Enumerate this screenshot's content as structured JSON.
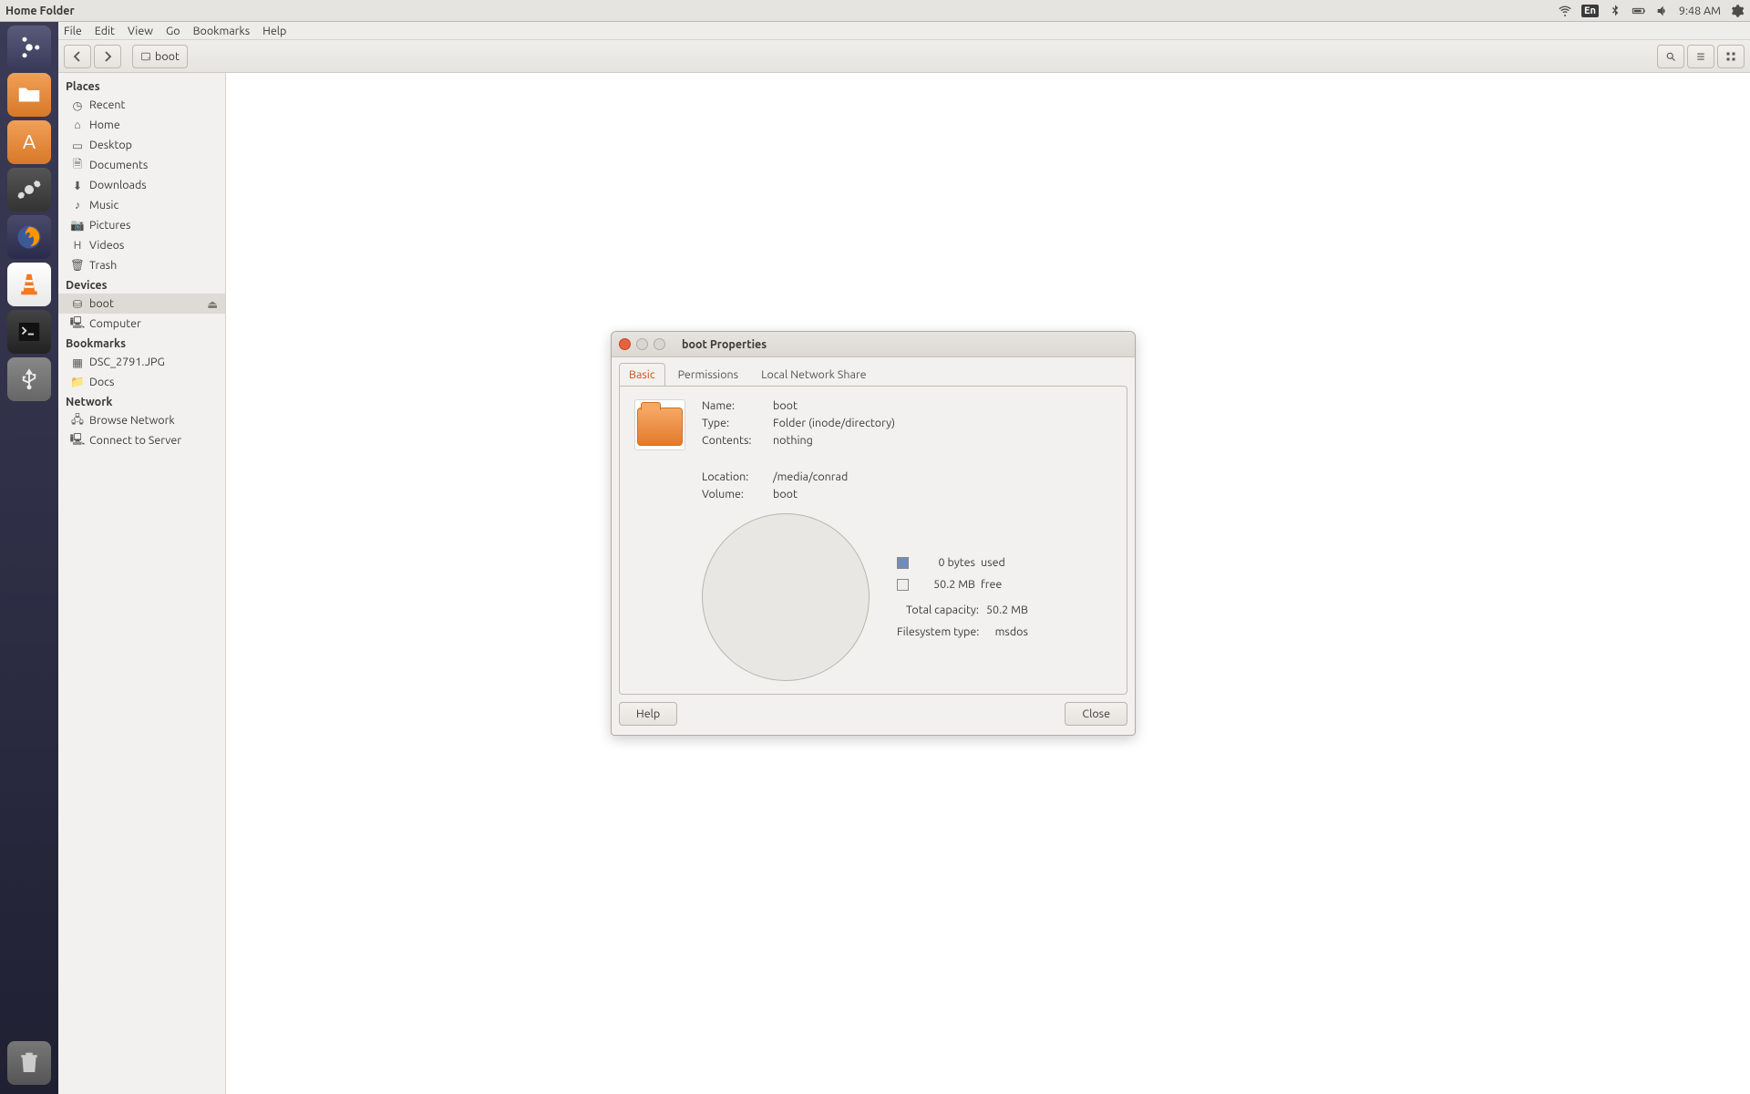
{
  "panel": {
    "title": "Home Folder",
    "lang_indicator": "En",
    "time": "9:48 AM"
  },
  "menubar": {
    "items": [
      "File",
      "Edit",
      "View",
      "Go",
      "Bookmarks",
      "Help"
    ]
  },
  "toolbar": {
    "path_label": "boot"
  },
  "sidebar": {
    "sections": [
      {
        "title": "Places",
        "items": [
          {
            "icon": "clock-icon",
            "label": "Recent"
          },
          {
            "icon": "home-icon",
            "label": "Home"
          },
          {
            "icon": "desktop-icon",
            "label": "Desktop"
          },
          {
            "icon": "doc-icon",
            "label": "Documents"
          },
          {
            "icon": "download-icon",
            "label": "Downloads"
          },
          {
            "icon": "music-icon",
            "label": "Music"
          },
          {
            "icon": "camera-icon",
            "label": "Pictures"
          },
          {
            "icon": "video-icon",
            "label": "Videos"
          },
          {
            "icon": "trash-icon",
            "label": "Trash"
          }
        ]
      },
      {
        "title": "Devices",
        "items": [
          {
            "icon": "drive-icon",
            "label": "boot",
            "active": true,
            "eject": true
          },
          {
            "icon": "computer-icon",
            "label": "Computer"
          }
        ]
      },
      {
        "title": "Bookmarks",
        "items": [
          {
            "icon": "image-icon",
            "label": "DSC_2791.JPG"
          },
          {
            "icon": "folder-icon",
            "label": "Docs"
          }
        ]
      },
      {
        "title": "Network",
        "items": [
          {
            "icon": "network-icon",
            "label": "Browse Network"
          },
          {
            "icon": "server-icon",
            "label": "Connect to Server"
          }
        ]
      }
    ]
  },
  "dialog": {
    "title": "boot Properties",
    "tabs": [
      "Basic",
      "Permissions",
      "Local Network Share"
    ],
    "active_tab": "Basic",
    "name_label": "Name:",
    "name_value": "boot",
    "type_label": "Type:",
    "type_value": "Folder (inode/directory)",
    "contents_label": "Contents:",
    "contents_value": "nothing",
    "location_label": "Location:",
    "location_value": "/media/conrad",
    "volume_label": "Volume:",
    "volume_value": "boot",
    "used_value": "0 bytes",
    "used_label": "used",
    "free_value": "50.2 MB",
    "free_label": "free",
    "capacity_label": "Total capacity:",
    "capacity_value": "50.2 MB",
    "fstype_label": "Filesystem type:",
    "fstype_value": "msdos",
    "help_button": "Help",
    "close_button": "Close"
  }
}
